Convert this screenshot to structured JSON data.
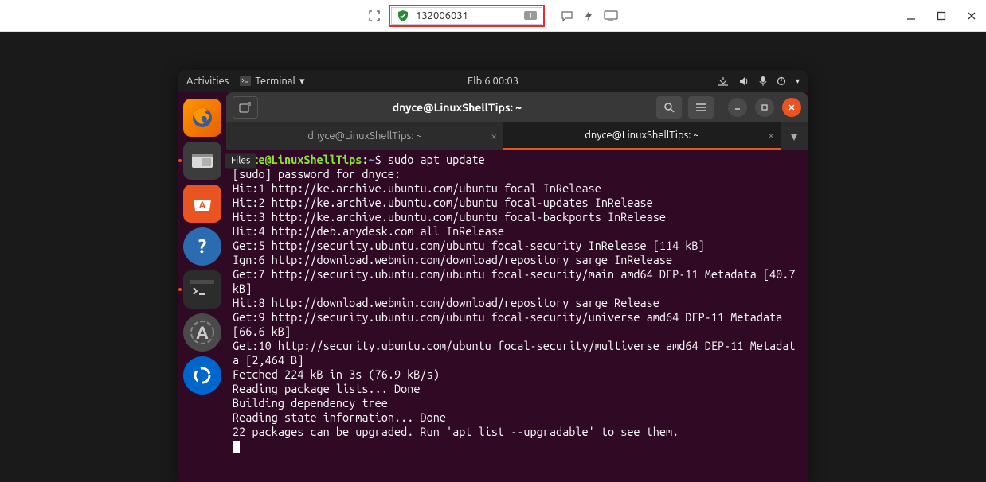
{
  "anydesk_bar": {
    "id": "132006031",
    "badge": "1"
  },
  "window_controls": {
    "minimize": "—",
    "maximize": "▢",
    "close": "✕"
  },
  "topbar": {
    "activities": "Activities",
    "app": "Terminal",
    "clock": "Elb 6  00:03"
  },
  "dock": {
    "firefox": "firefox",
    "files": "files",
    "files_tooltip": "Files",
    "software": "software",
    "help": "help",
    "terminal": "terminal",
    "updates": "updates",
    "anydesk": "anydesk"
  },
  "terminal": {
    "title": "dnyce@LinuxShellTips: ~",
    "tabs": [
      {
        "label": "dnyce@LinuxShellTips: ~",
        "active": false
      },
      {
        "label": "dnyce@LinuxShellTips: ~",
        "active": true
      }
    ],
    "prompt_user": "dnyce@LinuxShellTips",
    "prompt_sep": ":",
    "prompt_path": "~",
    "prompt_sym": "$",
    "command": "sudo apt update",
    "output": [
      "[sudo] password for dnyce: ",
      "Hit:1 http://ke.archive.ubuntu.com/ubuntu focal InRelease",
      "Hit:2 http://ke.archive.ubuntu.com/ubuntu focal-updates InRelease",
      "Hit:3 http://ke.archive.ubuntu.com/ubuntu focal-backports InRelease",
      "Hit:4 http://deb.anydesk.com all InRelease",
      "Get:5 http://security.ubuntu.com/ubuntu focal-security InRelease [114 kB]",
      "Ign:6 http://download.webmin.com/download/repository sarge InRelease",
      "Get:7 http://security.ubuntu.com/ubuntu focal-security/main amd64 DEP-11 Metadata [40.7 kB]",
      "Hit:8 http://download.webmin.com/download/repository sarge Release",
      "Get:9 http://security.ubuntu.com/ubuntu focal-security/universe amd64 DEP-11 Metadata [66.6 kB]",
      "Get:10 http://security.ubuntu.com/ubuntu focal-security/multiverse amd64 DEP-11 Metadata [2,464 B]",
      "Fetched 224 kB in 3s (76.9 kB/s)",
      "Reading package lists... Done",
      "Building dependency tree",
      "Reading state information... Done",
      "22 packages can be upgraded. Run 'apt list --upgradable' to see them."
    ]
  }
}
